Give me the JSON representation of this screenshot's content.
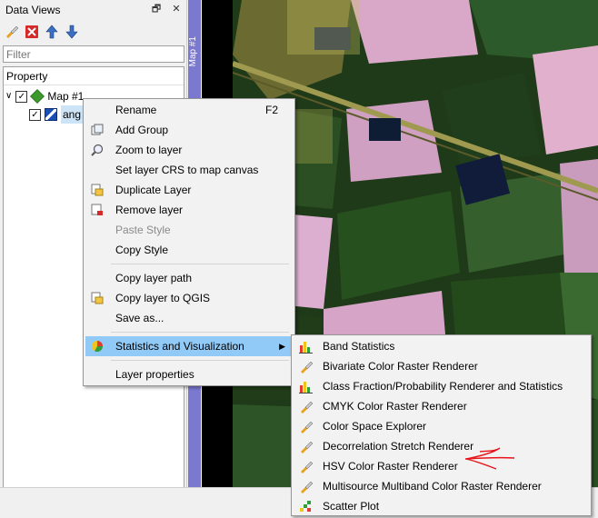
{
  "dock": {
    "title": "Data Views",
    "float_glyph": "🗗",
    "close_glyph": "✕",
    "filter_placeholder": "Filter",
    "tree_header": "Property",
    "map_item": "Map #1",
    "layer_item": "ang",
    "expand_glyph": "∨",
    "check_glyph": "✓"
  },
  "map": {
    "tab_label": "Map #1"
  },
  "context_menu": {
    "items": [
      {
        "label": "Rename",
        "shortcut": "F2"
      },
      {
        "label": "Add Group"
      },
      {
        "label": "Zoom to layer"
      },
      {
        "label": "Set layer CRS to map canvas"
      },
      {
        "label": "Duplicate Layer"
      },
      {
        "label": "Remove layer"
      },
      {
        "label": "Paste Style"
      },
      {
        "label": "Copy Style"
      },
      {
        "label": "Copy layer path"
      },
      {
        "label": "Copy layer to QGIS"
      },
      {
        "label": "Save as..."
      },
      {
        "label": "Statistics and Visualization"
      },
      {
        "label": "Layer properties"
      }
    ],
    "submenu_arrow": "▶"
  },
  "submenu": {
    "items": [
      "Band Statistics",
      "Bivariate Color Raster Renderer",
      "Class Fraction/Probability Renderer and Statistics",
      "CMYK Color Raster Renderer",
      "Color Space Explorer",
      "Decorrelation Stretch Renderer",
      "HSV Color Raster Renderer",
      "Multisource Multiband Color Raster Renderer",
      "Scatter Plot"
    ]
  },
  "colors": {
    "highlight": "#91c9f7",
    "map_strip": "#7b78d0",
    "annotation": "#e8141a"
  }
}
